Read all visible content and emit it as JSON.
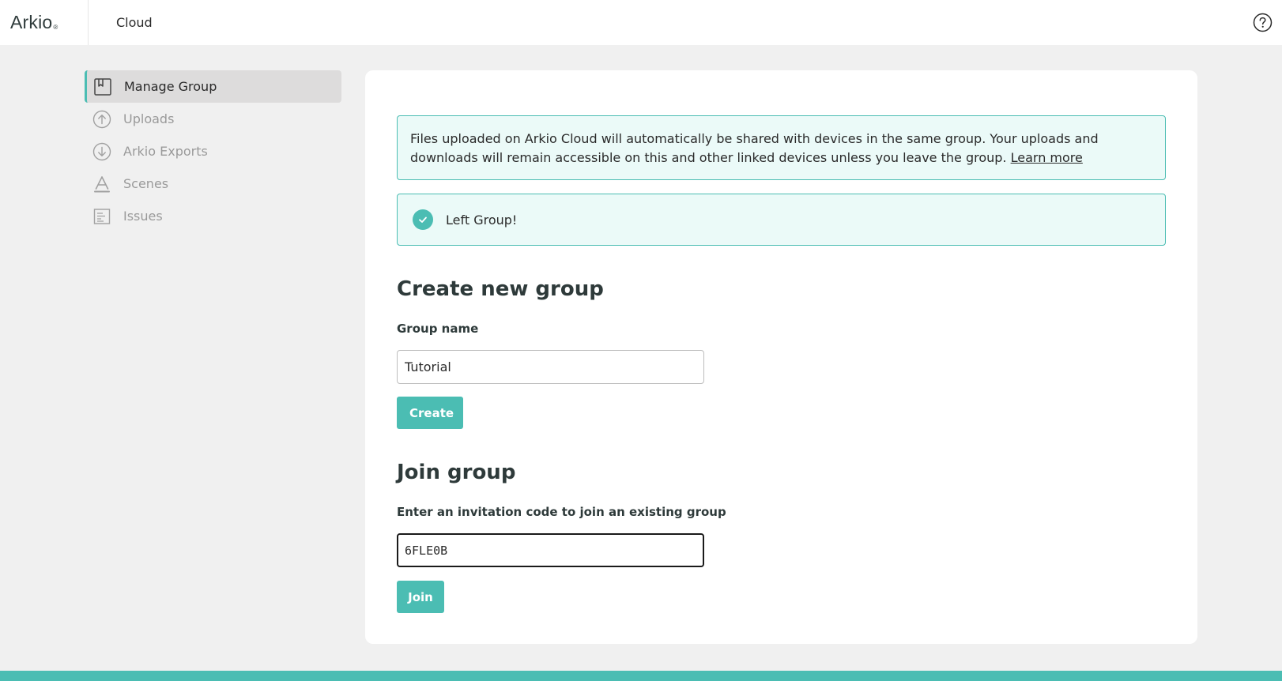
{
  "header": {
    "logo_text": "Arkio",
    "logo_mark": "®",
    "title": "Cloud",
    "help_icon": "question-circle-icon"
  },
  "sidebar": {
    "items": [
      {
        "label": "Manage Group",
        "icon": "bookmark-icon",
        "active": true
      },
      {
        "label": "Uploads",
        "icon": "arrow-up-circle-icon",
        "active": false
      },
      {
        "label": "Arkio Exports",
        "icon": "arrow-down-circle-icon",
        "active": false
      },
      {
        "label": "Scenes",
        "icon": "scenes-triangle-icon",
        "active": false
      },
      {
        "label": "Issues",
        "icon": "issues-list-icon",
        "active": false
      }
    ]
  },
  "main": {
    "info_text": "Files uploaded on Arkio Cloud will automatically be shared with devices in the same group. Your uploads and downloads will remain accessible on this and other linked devices unless you leave the group.",
    "learn_more": "Learn more",
    "success_text": "Left Group!",
    "create": {
      "title": "Create new group",
      "label": "Group name",
      "value": "Tutorial",
      "button": "Create"
    },
    "join": {
      "title": "Join group",
      "label": "Enter an invitation code to join an existing group",
      "value": "6FLE0B",
      "button": "Join"
    }
  },
  "colors": {
    "accent": "#4bbdb3",
    "notice_bg": "#ebfaf8",
    "page_bg": "#f0f0f0",
    "active_nav_bg": "#dddcdc"
  }
}
